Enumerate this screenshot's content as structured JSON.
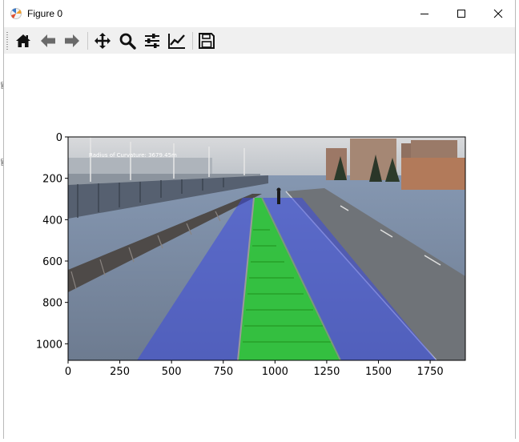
{
  "window": {
    "title": "Figure 0"
  },
  "toolbar": {
    "buttons": [
      {
        "name": "home",
        "icon": "home-icon"
      },
      {
        "name": "back",
        "icon": "arrow-left-icon"
      },
      {
        "name": "forward",
        "icon": "arrow-right-icon"
      },
      {
        "name": "pan",
        "icon": "move-icon"
      },
      {
        "name": "zoom",
        "icon": "magnifier-icon"
      },
      {
        "name": "subplots",
        "icon": "sliders-icon"
      },
      {
        "name": "customize",
        "icon": "line-chart-icon"
      },
      {
        "name": "save",
        "icon": "floppy-disk-icon"
      }
    ]
  },
  "figure": {
    "overlay_text": "Radius of Curvature: 3679.45m",
    "x_ticks": [
      "0",
      "250",
      "500",
      "750",
      "1000",
      "1250",
      "1500",
      "1750"
    ],
    "y_ticks": [
      "0",
      "200",
      "400",
      "600",
      "800",
      "1000"
    ],
    "x_range": [
      0,
      1920
    ],
    "y_range": [
      1080,
      0
    ],
    "colors": {
      "track_overlay": "#2fd02a",
      "ground_overlay": "#3a48e0",
      "sky": "#cfd2d6"
    }
  }
}
